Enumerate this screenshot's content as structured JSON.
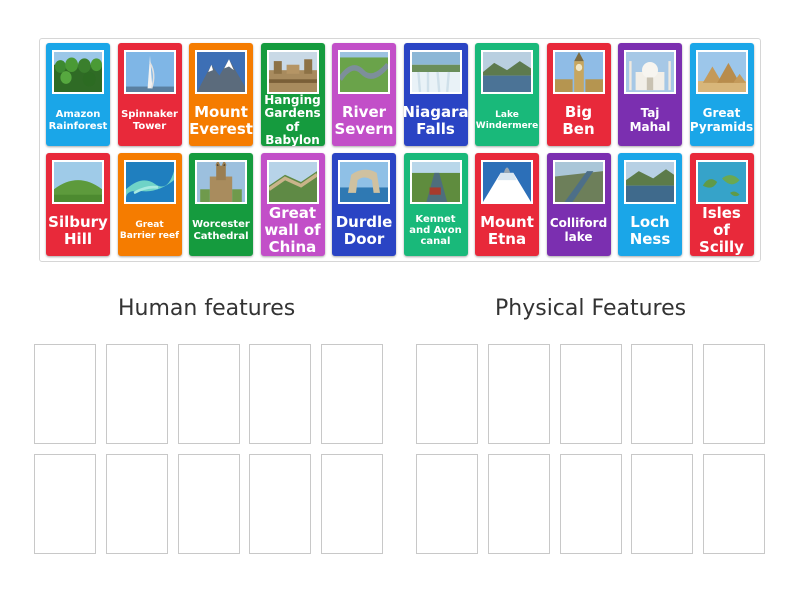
{
  "cards": [
    {
      "label": "Amazon Rainforest",
      "color": "#1aa6e8",
      "size": "s",
      "art": "forest"
    },
    {
      "label": "Spinnaker Tower",
      "color": "#e8293a",
      "size": "s",
      "art": "tower"
    },
    {
      "label": "Mount Everest",
      "color": "#f57c00",
      "size": "l",
      "art": "mountain"
    },
    {
      "label": "Hanging Gardens of Babylon",
      "color": "#159b3e",
      "size": "m",
      "art": "ruins"
    },
    {
      "label": "River Severn",
      "color": "#c24fc8",
      "size": "l",
      "art": "river"
    },
    {
      "label": "Niagara Falls",
      "color": "#2a44c4",
      "size": "l",
      "art": "falls"
    },
    {
      "label": "Lake Windermere",
      "color": "#19b97a",
      "size": "xs",
      "art": "lake"
    },
    {
      "label": "Big Ben",
      "color": "#e8293a",
      "size": "l",
      "art": "bigben"
    },
    {
      "label": "Taj Mahal",
      "color": "#7b2fb0",
      "size": "m",
      "art": "taj"
    },
    {
      "label": "Great Pyramids",
      "color": "#1aa6e8",
      "size": "m",
      "art": "pyramids"
    },
    {
      "label": "Silbury Hill",
      "color": "#e8293a",
      "size": "l",
      "art": "hill"
    },
    {
      "label": "Great Barrier reef",
      "color": "#f57c00",
      "size": "xs",
      "art": "reef"
    },
    {
      "label": "Worcester Cathedral",
      "color": "#159b3e",
      "size": "s",
      "art": "cathedral"
    },
    {
      "label": "Great wall of China",
      "color": "#c24fc8",
      "size": "l",
      "art": "wall"
    },
    {
      "label": "Durdle Door",
      "color": "#2a44c4",
      "size": "l",
      "art": "arch"
    },
    {
      "label": "Kennet and Avon canal",
      "color": "#19b97a",
      "size": "s",
      "art": "canal"
    },
    {
      "label": "Mount Etna",
      "color": "#e8293a",
      "size": "l",
      "art": "volcano"
    },
    {
      "label": "Colliford lake",
      "color": "#7b2fb0",
      "size": "m",
      "art": "dam"
    },
    {
      "label": "Loch Ness",
      "color": "#1aa6e8",
      "size": "l",
      "art": "loch"
    },
    {
      "label": "Isles of Scilly",
      "color": "#e8293a",
      "size": "l",
      "art": "isles"
    }
  ],
  "groups": [
    {
      "title": "Human features"
    },
    {
      "title": "Physical Features"
    }
  ]
}
